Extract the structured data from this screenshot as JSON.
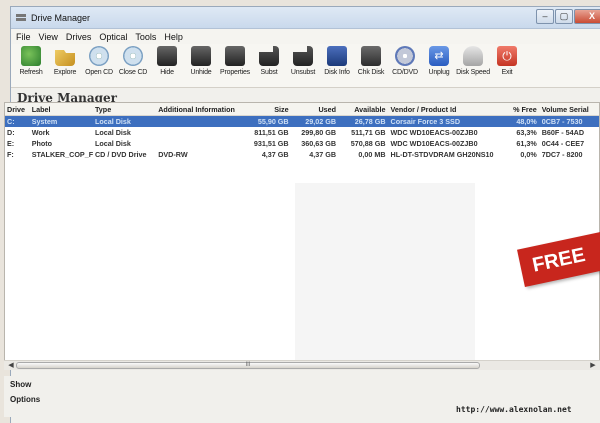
{
  "window": {
    "title": "Drive Manager",
    "minimize": "‒",
    "maximize": "▢",
    "close": "X"
  },
  "menu": [
    "File",
    "View",
    "Drives",
    "Optical",
    "Tools",
    "Help"
  ],
  "toolbar": [
    {
      "label": "Refresh",
      "icon": "refresh-icon"
    },
    {
      "label": "Explore",
      "icon": "folder-icon"
    },
    {
      "label": "Open CD",
      "icon": "cd-open-icon"
    },
    {
      "label": "Close CD",
      "icon": "cd-close-icon"
    },
    {
      "label": "Hide",
      "icon": "hide-drive-icon"
    },
    {
      "label": "Unhide",
      "icon": "unhide-drive-icon"
    },
    {
      "label": "Properties",
      "icon": "properties-icon"
    },
    {
      "label": "Subst",
      "icon": "subst-icon"
    },
    {
      "label": "Unsubst",
      "icon": "unsubst-icon"
    },
    {
      "label": "Disk Info",
      "icon": "disk-info-icon"
    },
    {
      "label": "Chk Disk",
      "icon": "check-disk-icon"
    },
    {
      "label": "CD/DVD",
      "icon": "cd-dvd-icon"
    },
    {
      "label": "Unplug",
      "icon": "unplug-icon"
    },
    {
      "label": "Disk Speed",
      "icon": "disk-speed-icon"
    },
    {
      "label": "Exit",
      "icon": "exit-icon"
    }
  ],
  "heading": "Drive Manager",
  "columns": [
    "Drive",
    "Label",
    "Type",
    "Additional Information",
    "Size",
    "Used",
    "Available",
    "Vendor / Product Id",
    "% Free",
    "Volume Serial"
  ],
  "rows": [
    {
      "drive": "C:",
      "label": "System",
      "type": "Local Disk",
      "info": "",
      "size": "55,90 GB",
      "used": "29,02 GB",
      "available": "26,78 GB",
      "vendor": "Corsair Force 3 SSD",
      "free": "48,0%",
      "serial": "0CB7 - 7530",
      "selected": true
    },
    {
      "drive": "D:",
      "label": "Work",
      "type": "Local Disk",
      "info": "",
      "size": "811,51 GB",
      "used": "299,80 GB",
      "available": "511,71 GB",
      "vendor": "WDC WD10EACS-00ZJB0",
      "free": "63,3%",
      "serial": "B60F - 54AD",
      "selected": false
    },
    {
      "drive": "E:",
      "label": "Photo",
      "type": "Local Disk",
      "info": "",
      "size": "931,51 GB",
      "used": "360,63 GB",
      "available": "570,88 GB",
      "vendor": "WDC WD10EACS-00ZJB0",
      "free": "61,3%",
      "serial": "0C44 - CEE7",
      "selected": false
    },
    {
      "drive": "F:",
      "label": "STALKER_COP_F",
      "type": "CD / DVD Drive",
      "info": "DVD-RW",
      "size": "4,37 GB",
      "used": "4,37 GB",
      "available": "0,00 MB",
      "vendor": "HL-DT-STDVDRAM GH20NS10",
      "free": "0,0%",
      "serial": "7DC7 - 8200",
      "selected": false
    }
  ],
  "scrollbar": {
    "left": "◀",
    "right": "▶",
    "grip": "III"
  },
  "bottom": {
    "show": "Show",
    "options": "Options",
    "url": "http://www.alexnolan.net"
  },
  "banner": "FREE"
}
